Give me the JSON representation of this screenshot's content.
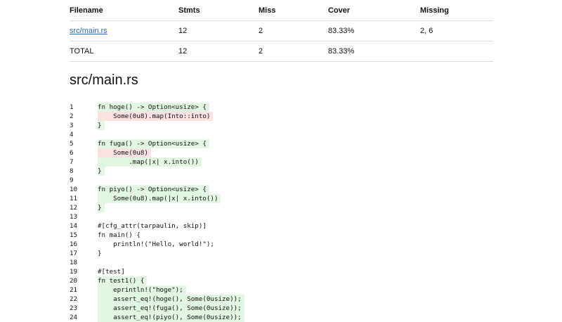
{
  "table": {
    "headers": [
      "Filename",
      "Stmts",
      "Miss",
      "Cover",
      "Missing"
    ],
    "rows": [
      {
        "filename": "src/main.rs",
        "stmts": "12",
        "miss": "2",
        "cover": "83.33%",
        "missing": "2, 6"
      },
      {
        "filename": "TOTAL",
        "stmts": "12",
        "miss": "2",
        "cover": "83.33%",
        "missing": ""
      }
    ]
  },
  "file_title": "src/main.rs",
  "lines": [
    {
      "n": "1",
      "text": "fn hoge() -> Option<usize> {",
      "status": "hit"
    },
    {
      "n": "2",
      "text": "    Some(0u8).map(Into::into)",
      "status": "miss"
    },
    {
      "n": "3",
      "text": "}",
      "status": "hit"
    },
    {
      "n": "4",
      "text": "",
      "status": "none"
    },
    {
      "n": "5",
      "text": "fn fuga() -> Option<usize> {",
      "status": "hit"
    },
    {
      "n": "6",
      "text": "    Some(0u8)",
      "status": "miss"
    },
    {
      "n": "7",
      "text": "        .map(|x| x.into())",
      "status": "hit"
    },
    {
      "n": "8",
      "text": "}",
      "status": "hit"
    },
    {
      "n": "9",
      "text": "",
      "status": "none"
    },
    {
      "n": "10",
      "text": "fn piyo() -> Option<usize> {",
      "status": "hit"
    },
    {
      "n": "11",
      "text": "    Some(0u8).map(|x| x.into())",
      "status": "hit"
    },
    {
      "n": "12",
      "text": "}",
      "status": "hit"
    },
    {
      "n": "13",
      "text": "",
      "status": "none"
    },
    {
      "n": "14",
      "text": "#[cfg_attr(tarpaulin, skip)]",
      "status": "none"
    },
    {
      "n": "15",
      "text": "fn main() {",
      "status": "none"
    },
    {
      "n": "16",
      "text": "    println!(\"Hello, world!\");",
      "status": "none"
    },
    {
      "n": "17",
      "text": "}",
      "status": "none"
    },
    {
      "n": "18",
      "text": "",
      "status": "none"
    },
    {
      "n": "19",
      "text": "#[test]",
      "status": "none"
    },
    {
      "n": "20",
      "text": "fn test1() {",
      "status": "hit"
    },
    {
      "n": "21",
      "text": "    eprintln!(\"hoge\");",
      "status": "hit"
    },
    {
      "n": "22",
      "text": "    assert_eq!(hoge(), Some(0usize));",
      "status": "hit"
    },
    {
      "n": "23",
      "text": "    assert_eq!(fuga(), Some(0usize));",
      "status": "hit"
    },
    {
      "n": "24",
      "text": "    assert_eq!(piyo(), Some(0usize));",
      "status": "hit"
    }
  ]
}
